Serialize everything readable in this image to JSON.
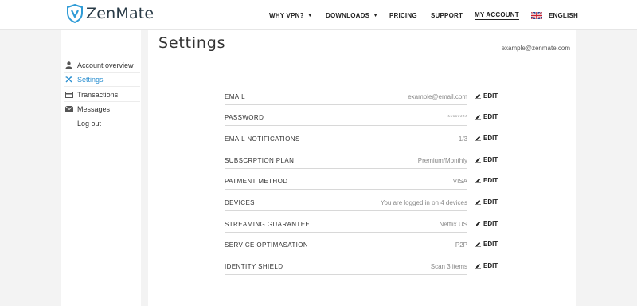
{
  "header": {
    "logo_text": "ZenMate",
    "nav": {
      "why_vpn": "WHY VPN?",
      "downloads": "DOWNLOADS",
      "pricing": "PRICING",
      "support": "SUPPORT",
      "my_account": "MY ACCOUNT",
      "language": "ENGLISH"
    },
    "caret_glyph": "▼"
  },
  "sidebar": {
    "items": [
      {
        "label": "Account overview",
        "icon": "user-icon",
        "active": false
      },
      {
        "label": "Settings",
        "icon": "tools-icon",
        "active": true
      },
      {
        "label": "Transactions",
        "icon": "credit-card-icon",
        "active": false
      },
      {
        "label": "Messages",
        "icon": "envelope-icon",
        "active": false
      },
      {
        "label": "Log out",
        "icon": "",
        "active": false
      }
    ]
  },
  "main": {
    "title": "Settings",
    "user_email": "example@zenmate.com",
    "edit_label": "EDIT",
    "settings": [
      {
        "label": "EMAIL",
        "value": "example@email.com"
      },
      {
        "label": "PASSWORD",
        "value": "********"
      },
      {
        "label": "EMAIL NOTIFICATIONS",
        "value": "1/3"
      },
      {
        "label": "SUBSCRPTION PLAN",
        "value": "Premium/Monthly"
      },
      {
        "label": "PATMENT METHOD",
        "value": "VISA"
      },
      {
        "label": "DEVICES",
        "value": "You are logged in on 4 devices"
      },
      {
        "label": "STREAMING GUARANTEE",
        "value": "Netflix US"
      },
      {
        "label": "SERVICE OPTIMASATION",
        "value": "P2P"
      },
      {
        "label": "IDENTITY SHIELD",
        "value": "Scan 3 items"
      }
    ]
  },
  "colors": {
    "accent": "#2b8fd0",
    "logo_shield": "#2e9bd6",
    "background": "#f3f3f3"
  }
}
